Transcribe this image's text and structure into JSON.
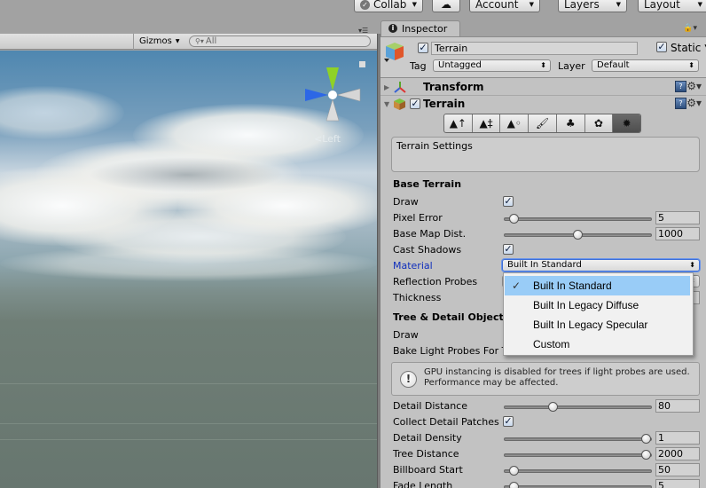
{
  "toolbar": {
    "collab": "Collab",
    "account": "Account",
    "layers": "Layers",
    "layout": "Layout"
  },
  "scene": {
    "gizmos_label": "Gizmos",
    "search_placeholder": "All",
    "orientation_label": "Left"
  },
  "inspector": {
    "tab_label": "Inspector",
    "object": {
      "active": true,
      "name": "Terrain",
      "static_label": "Static",
      "static": true,
      "tag_label": "Tag",
      "tag_value": "Untagged",
      "layer_label": "Layer",
      "layer_value": "Default"
    },
    "components": [
      {
        "name": "Transform",
        "expanded": false
      },
      {
        "name": "Terrain",
        "expanded": true,
        "enabled": true
      }
    ],
    "terrain_tools": [
      "raise-lower-terrain",
      "paint-height",
      "smooth-height",
      "paint-texture",
      "place-trees",
      "paint-details",
      "terrain-settings"
    ],
    "active_tool": "terrain-settings",
    "settings_title": "Terrain Settings",
    "base_terrain": {
      "heading": "Base Terrain",
      "draw_label": "Draw",
      "draw": true,
      "pixel_error_label": "Pixel Error",
      "pixel_error": "5",
      "pixel_error_fraction": 0.03,
      "base_map_dist_label": "Base Map Dist.",
      "base_map_dist": "1000",
      "base_map_dist_fraction": 0.5,
      "cast_shadows_label": "Cast Shadows",
      "cast_shadows": true,
      "material_label": "Material",
      "material_value": "Built In Standard",
      "reflection_probes_label": "Reflection Probes",
      "thickness_label": "Thickness"
    },
    "tree_detail": {
      "heading": "Tree & Detail Objects",
      "draw_label": "Draw",
      "bake_label": "Bake Light Probes For Trees",
      "warning": "GPU instancing is disabled for trees if light probes are used.",
      "warning_line2": "Performance may be affected.",
      "detail_distance_label": "Detail Distance",
      "detail_distance": "80",
      "detail_distance_fraction": 0.32,
      "collect_label": "Collect Detail Patches",
      "collect": true,
      "detail_density_label": "Detail Density",
      "detail_density": "1",
      "detail_density_fraction": 1.0,
      "tree_distance_label": "Tree Distance",
      "tree_distance": "2000",
      "tree_distance_fraction": 1.0,
      "billboard_start_label": "Billboard Start",
      "billboard_start": "50",
      "billboard_start_fraction": 0.03,
      "fade_length_label": "Fade Length",
      "fade_length": "5",
      "fade_length_fraction": 0.03
    }
  },
  "material_dropdown": {
    "selected_index": 0,
    "options": [
      "Built In Standard",
      "Built In Legacy Diffuse",
      "Built In Legacy Specular",
      "Custom"
    ]
  }
}
